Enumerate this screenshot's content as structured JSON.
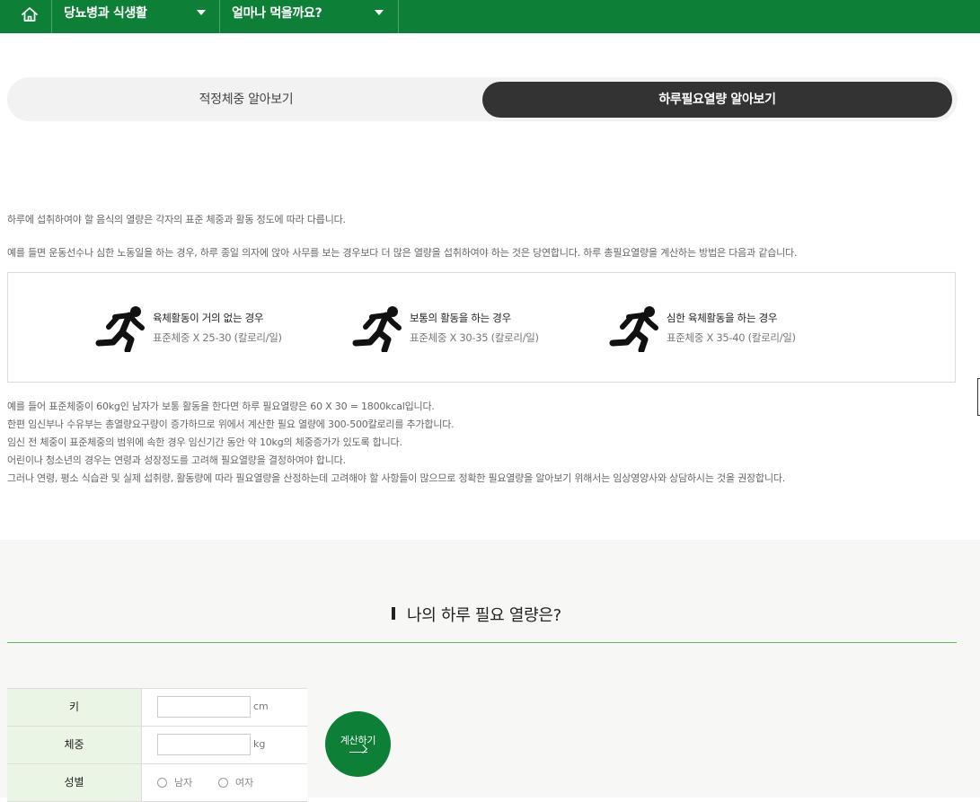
{
  "nav": {
    "home_icon": "home-icon",
    "menu1": "당뇨병과 식생활",
    "menu2": "얼마나 먹을까요?"
  },
  "tabs": [
    {
      "label": "적정체중 알아보기",
      "active": false
    },
    {
      "label": "하루필요열량 알아보기",
      "active": true
    }
  ],
  "intro": [
    "하루에 섭취하여야 할 음식의 열량은 각자의 표준 체중과 활동 정도에 따라 다릅니다.",
    "예를 들면 운동선수나 심한 노동일을 하는 경우, 하루 종일 의자에 앉아 사무를 보는 경우보다 더 많은 열량을 섭취하여야 하는 것은 당연합니다. 하루 총필요열량을 계산하는 방법은 다음과 같습니다."
  ],
  "activities": [
    {
      "icon": "running-person-icon",
      "title": "육체활동이 거의 없는 경우",
      "formula": "표준체중 X 25-30 (칼로리/일)"
    },
    {
      "icon": "running-person-icon",
      "title": "보통의 활동을 하는 경우",
      "formula": "표준체중 X 30-35 (칼로리/일)"
    },
    {
      "icon": "running-person-icon",
      "title": "심한 육체활동을 하는 경우",
      "formula": "표준체중 X 35-40 (칼로리/일)"
    }
  ],
  "notes": [
    "예를 들어 표준체중이 60kg인 남자가 보통 활동을 한다면 하루 필요열량은 60 X 30 = 1800kcal입니다.",
    "한편 임신부나 수유부는 총열량요구량이 증가하므로 위에서 계산한 필요 열량에 300-500칼로리를 추가합니다.",
    "임신 전 체중이 표준체중의 범위에 속한 경우 임신기간 동안 약 10kg의 체중증가가 있도록 합니다.",
    "어린이나 청소년의 경우는 연령과 성장정도를 고려해 필요열량을 결정하여야 합니다.",
    "그러나 연령, 평소 식습관 및 실제 섭취량, 활동량에 따라 필요열량을 산정하는데 고려해야 할 사항들이 많으므로 정확한 필요열량을 알아보기 위해서는 임상영양사와 상담하시는 것을 권장합니다."
  ],
  "calculator": {
    "title": "나의 하루 필요 열량은?",
    "height_label": "키",
    "height_value": "",
    "height_unit": "cm",
    "weight_label": "체중",
    "weight_value": "",
    "weight_unit": "kg",
    "gender_label": "성별",
    "gender_options": [
      "남자",
      "여자"
    ],
    "submit_label": "계산하기"
  },
  "colors": {
    "brand_green": "#0e7f36",
    "active_tab": "#333333",
    "label_cell": "#eaf5e6",
    "section_bg": "#f7f7f5"
  }
}
